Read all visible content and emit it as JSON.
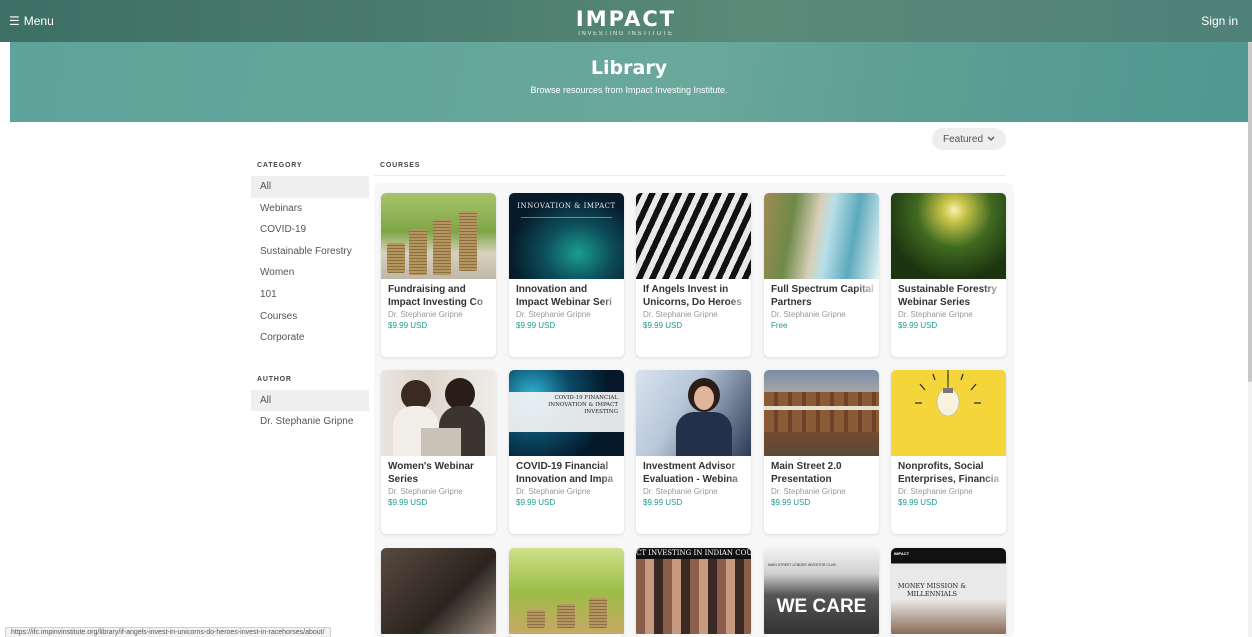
{
  "header": {
    "menu_label": "Menu",
    "logo_main": "IMPACT",
    "logo_sub": "INVESTING INSTITUTE",
    "signin_label": "Sign in"
  },
  "hero": {
    "title": "Library",
    "subtitle": "Browse resources from Impact Investing Institute."
  },
  "sort": {
    "label": "Featured"
  },
  "sidebar": {
    "category_heading": "CATEGORY",
    "categories": [
      "All",
      "Webinars",
      "COVID-19",
      "Sustainable Forestry",
      "Women",
      "101",
      "Courses",
      "Corporate"
    ],
    "author_heading": "AUTHOR",
    "authors": [
      "All",
      "Dr. Stephanie Gripne"
    ]
  },
  "courses": {
    "heading": "COURSES",
    "cards": [
      {
        "title": "Fundraising and Impact Investing Co",
        "author": "Dr. Stephanie Gripne",
        "price": "$9.99 USD"
      },
      {
        "title": "Innovation and Impact Webinar Seri",
        "author": "Dr. Stephanie Gripne",
        "price": "$9.99 USD",
        "thumb_text": "INNOVATION & IMPACT"
      },
      {
        "title": "If Angels Invest in Unicorns, Do Heroes",
        "author": "Dr. Stephanie Gripne",
        "price": "$9.99 USD"
      },
      {
        "title": "Full Spectrum Capital Partners",
        "author": "Dr. Stephanie Gripne",
        "price": "Free"
      },
      {
        "title": "Sustainable Forestry Webinar Series",
        "author": "Dr. Stephanie Gripne",
        "price": "$9.99 USD"
      },
      {
        "title": "Women's Webinar Series",
        "author": "Dr. Stephanie Gripne",
        "price": "$9.99 USD"
      },
      {
        "title": "COVID-19 Financial Innovation and Impa",
        "author": "Dr. Stephanie Gripne",
        "price": "$9.99 USD",
        "thumb_text": "COVID-19 FINANCIAL INNOVATION & IMPACT INVESTING"
      },
      {
        "title": "Investment Advisor Evaluation - Webina",
        "author": "Dr. Stephanie Gripne",
        "price": "$9.99 USD"
      },
      {
        "title": "Main Street 2.0 Presentation",
        "author": "Dr. Stephanie Gripne",
        "price": "$9.99 USD"
      },
      {
        "title": "Nonprofits, Social Enterprises, Financia",
        "author": "Dr. Stephanie Gripne",
        "price": "$9.99 USD"
      }
    ],
    "partial_cards": [
      {
        "thumb_text": ""
      },
      {
        "thumb_text": ""
      },
      {
        "thumb_text": "CT INVESTING IN INDIAN COU"
      },
      {
        "thumb_text": "WE CARE",
        "thumb_small": "MAIN STREET LENDER INVESTOR CLUB"
      },
      {
        "thumb_text": "MONEY MISSION & MILLENNIALS",
        "thumb_small": "IMPACT"
      }
    ]
  },
  "status_bar": {
    "url": "https://ifc.impinvinstitute.org/library/if-angels-invest-in-unicorns-do-heroes-invest-in-racehorses/about/"
  }
}
